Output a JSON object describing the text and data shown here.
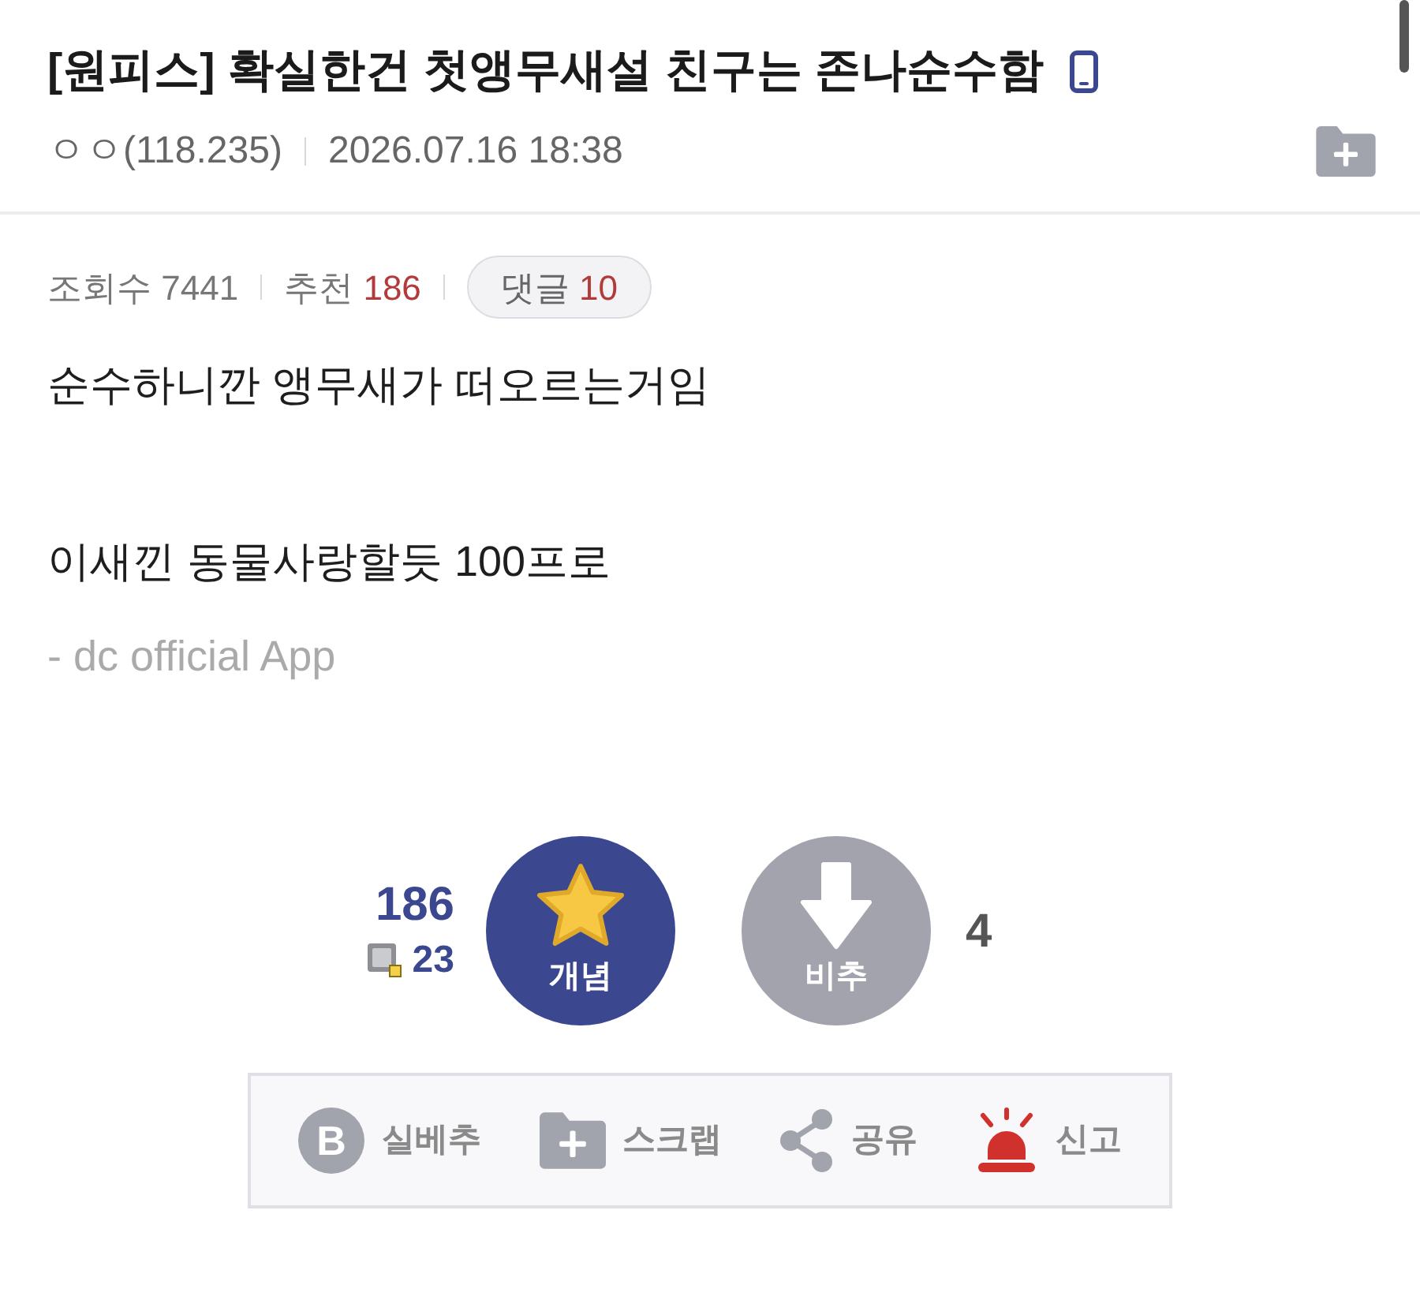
{
  "post": {
    "title": "[원피스] 확실한건 첫앵무새설 친구는 존나순수함",
    "mobile": true,
    "writer": "ㅇㅇ(118.235)",
    "date": "2026.07.16 18:38"
  },
  "stats": [
    {
      "label": "조회수",
      "value": "7441",
      "kind": "plain"
    },
    {
      "label": "추천",
      "value": "186",
      "kind": "accent"
    }
  ],
  "comments": {
    "label": "댓글",
    "value": "10"
  },
  "body": {
    "paragraphs": [
      "순수하니깐 앵무새가 떠오르는거임",
      "이새낀 동물사랑할듯 100프로"
    ],
    "signature": "- dc official App"
  },
  "vote": {
    "up": {
      "label": "개념",
      "count": "186",
      "fixed_count": "23"
    },
    "down": {
      "label": "비추",
      "count": "4"
    }
  },
  "actions": [
    {
      "kind": "best",
      "icon_text": "B",
      "label": "실베추"
    },
    {
      "kind": "scrap",
      "label": "스크랩"
    },
    {
      "kind": "share",
      "label": "공유"
    },
    {
      "kind": "report",
      "label": "신고"
    }
  ]
}
